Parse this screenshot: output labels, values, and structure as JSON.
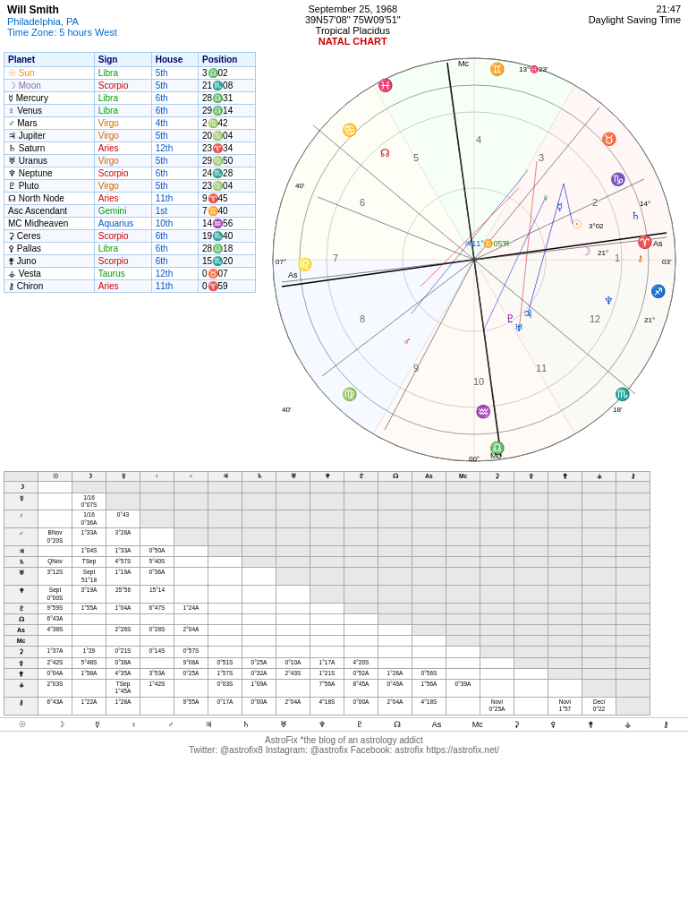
{
  "header": {
    "name": "Will Smith",
    "location": "Philadelphia, PA",
    "timezone": "Time Zone: 5 hours West",
    "date": "September 25, 1968",
    "coords": "39N57'08\" 75W09'51\"",
    "system": "Tropical Placidus",
    "chart_type": "NATAL CHART",
    "time": "21:47",
    "dst": "Daylight Saving Time"
  },
  "planets": [
    {
      "symbol": "☉",
      "name": "Sun",
      "sign": "Libra",
      "house": "5th",
      "position": "3♎02"
    },
    {
      "symbol": "☽",
      "name": "Moon",
      "sign": "Scorpio",
      "house": "5th",
      "position": "21♏08"
    },
    {
      "symbol": "☿",
      "name": "Mercury",
      "sign": "Libra",
      "house": "6th",
      "position": "28♎31"
    },
    {
      "symbol": "♀",
      "name": "Venus",
      "sign": "Libra",
      "house": "6th",
      "position": "29♎14"
    },
    {
      "symbol": "♂",
      "name": "Mars",
      "sign": "Virgo",
      "house": "4th",
      "position": "2♍42"
    },
    {
      "symbol": "♃",
      "name": "Jupiter",
      "sign": "Virgo",
      "house": "5th",
      "position": "20♍04"
    },
    {
      "symbol": "♄",
      "name": "Saturn",
      "sign": "Aries",
      "house": "12th",
      "position": "23♈34"
    },
    {
      "symbol": "♅",
      "name": "Uranus",
      "sign": "Virgo",
      "house": "5th",
      "position": "29♍50"
    },
    {
      "symbol": "♆",
      "name": "Neptune",
      "sign": "Scorpio",
      "house": "6th",
      "position": "24♏28"
    },
    {
      "symbol": "♇",
      "name": "Pluto",
      "sign": "Virgo",
      "house": "5th",
      "position": "23♍04"
    },
    {
      "symbol": "☊",
      "name": "North Node",
      "sign": "Aries",
      "house": "11th",
      "position": "9♈45"
    },
    {
      "symbol": "Asc",
      "name": "Ascendant",
      "sign": "Gemini",
      "house": "1st",
      "position": "7♊40"
    },
    {
      "symbol": "MC",
      "name": "Midheaven",
      "sign": "Aquarius",
      "house": "10th",
      "position": "14♒56"
    },
    {
      "symbol": "⚳",
      "name": "Ceres",
      "sign": "Scorpio",
      "house": "6th",
      "position": "19♏40"
    },
    {
      "symbol": "⚴",
      "name": "Pallas",
      "sign": "Libra",
      "house": "6th",
      "position": "28♎18"
    },
    {
      "symbol": "⚵",
      "name": "Juno",
      "sign": "Scorpio",
      "house": "6th",
      "position": "15♏20"
    },
    {
      "symbol": "⚶",
      "name": "Vesta",
      "sign": "Taurus",
      "house": "12th",
      "position": "0♉07"
    },
    {
      "symbol": "⚷",
      "name": "Chiron",
      "sign": "Aries",
      "house": "11th",
      "position": "0♈59"
    }
  ],
  "footer": {
    "line1": "AstroFix *the blog of an astrology addict",
    "line2": "Twitter: @astrofix8   Instagram: @astrofix   Facebook: astrofix   https://astrofix.net/"
  }
}
